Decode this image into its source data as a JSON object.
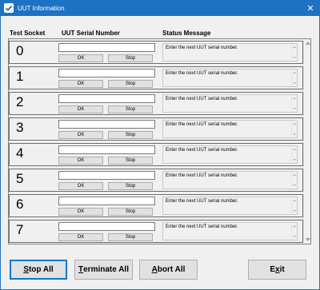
{
  "window": {
    "title": "UUT Information",
    "close_glyph": "✕"
  },
  "headers": {
    "socket": "Test Socket",
    "serial": "UUT Serial Number",
    "status": "Status Message"
  },
  "rows": [
    {
      "socket": "0",
      "serial": "",
      "ok": "OK",
      "stop": "Stop",
      "status": "Enter the next UUT serial number."
    },
    {
      "socket": "1",
      "serial": "",
      "ok": "OK",
      "stop": "Stop",
      "status": "Enter the next UUT serial number."
    },
    {
      "socket": "2",
      "serial": "",
      "ok": "OK",
      "stop": "Stop",
      "status": "Enter the next UUT serial number."
    },
    {
      "socket": "3",
      "serial": "",
      "ok": "OK",
      "stop": "Stop",
      "status": "Enter the next UUT serial number."
    },
    {
      "socket": "4",
      "serial": "",
      "ok": "OK",
      "stop": "Stop",
      "status": "Enter the next UUT serial number."
    },
    {
      "socket": "5",
      "serial": "",
      "ok": "OK",
      "stop": "Stop",
      "status": "Enter the next UUT serial number."
    },
    {
      "socket": "6",
      "serial": "",
      "ok": "OK",
      "stop": "Stop",
      "status": "Enter the next UUT serial number."
    },
    {
      "socket": "7",
      "serial": "",
      "ok": "OK",
      "stop": "Stop",
      "status": "Enter the next UUT serial number."
    }
  ],
  "buttons": {
    "stop_all": {
      "mnemonic": "S",
      "rest": "top All"
    },
    "terminate_all": {
      "mnemonic": "T",
      "rest": "erminate All"
    },
    "abort_all": {
      "mnemonic": "A",
      "rest": "bort All"
    },
    "exit": {
      "pre": "E",
      "mnemonic": "x",
      "rest": "it"
    }
  },
  "icons": {
    "app": "checkmark-app-icon",
    "close": "close-icon"
  },
  "colors": {
    "titlebar": "#1e72c3",
    "default_button_border": "#0078d7"
  }
}
